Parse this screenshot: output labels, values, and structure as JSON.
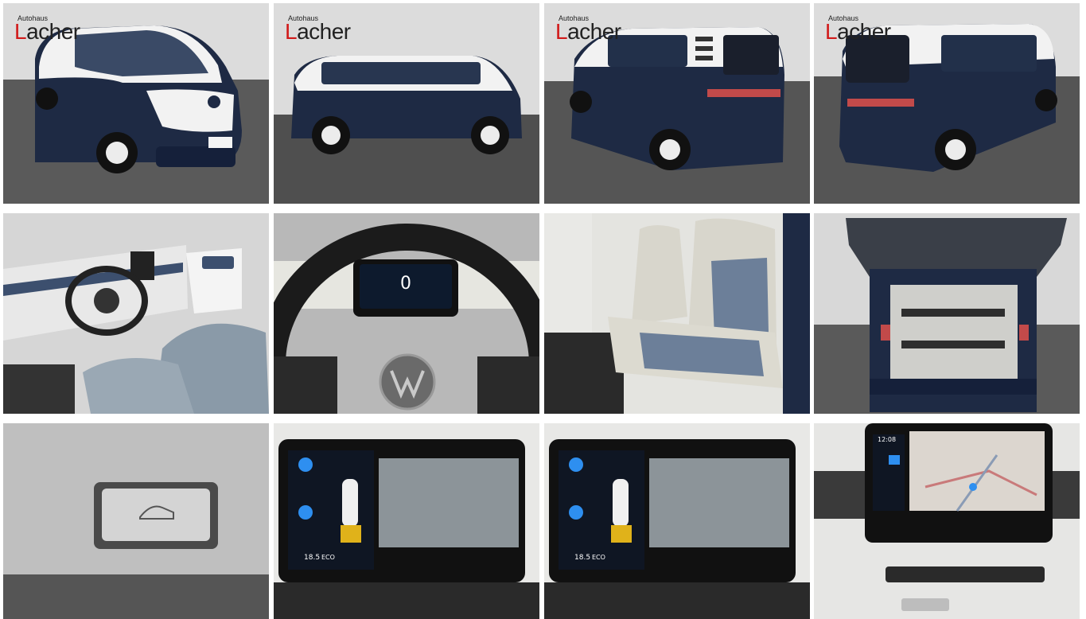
{
  "gallery": {
    "dealer_logo": {
      "small": "Autohaus",
      "main_l": "L",
      "main_rest": "acher"
    },
    "tiles": [
      {
        "id": "front-three-quarter"
      },
      {
        "id": "side-profile"
      },
      {
        "id": "rear-three-quarter-left"
      },
      {
        "id": "rear-three-quarter-right"
      },
      {
        "id": "cockpit-interior"
      },
      {
        "id": "steering-wheel"
      },
      {
        "id": "rear-bench"
      },
      {
        "id": "open-trunk"
      },
      {
        "id": "trunk-button"
      },
      {
        "id": "park-assist-screen-1"
      },
      {
        "id": "park-assist-screen-2"
      },
      {
        "id": "navigation-screen"
      }
    ],
    "screens": {
      "speed": "0",
      "climate_temp": "18.5",
      "climate_label": "ECO",
      "nav_time": "12:08"
    },
    "colors": {
      "body_navy": "#1e2a44",
      "roof_white": "#f2f2f2",
      "showroom_floor": "#555555",
      "showroom_wall": "#dcdcdc",
      "accent_blue": "#2e8ff0",
      "park_yellow": "#e0b21a"
    }
  }
}
